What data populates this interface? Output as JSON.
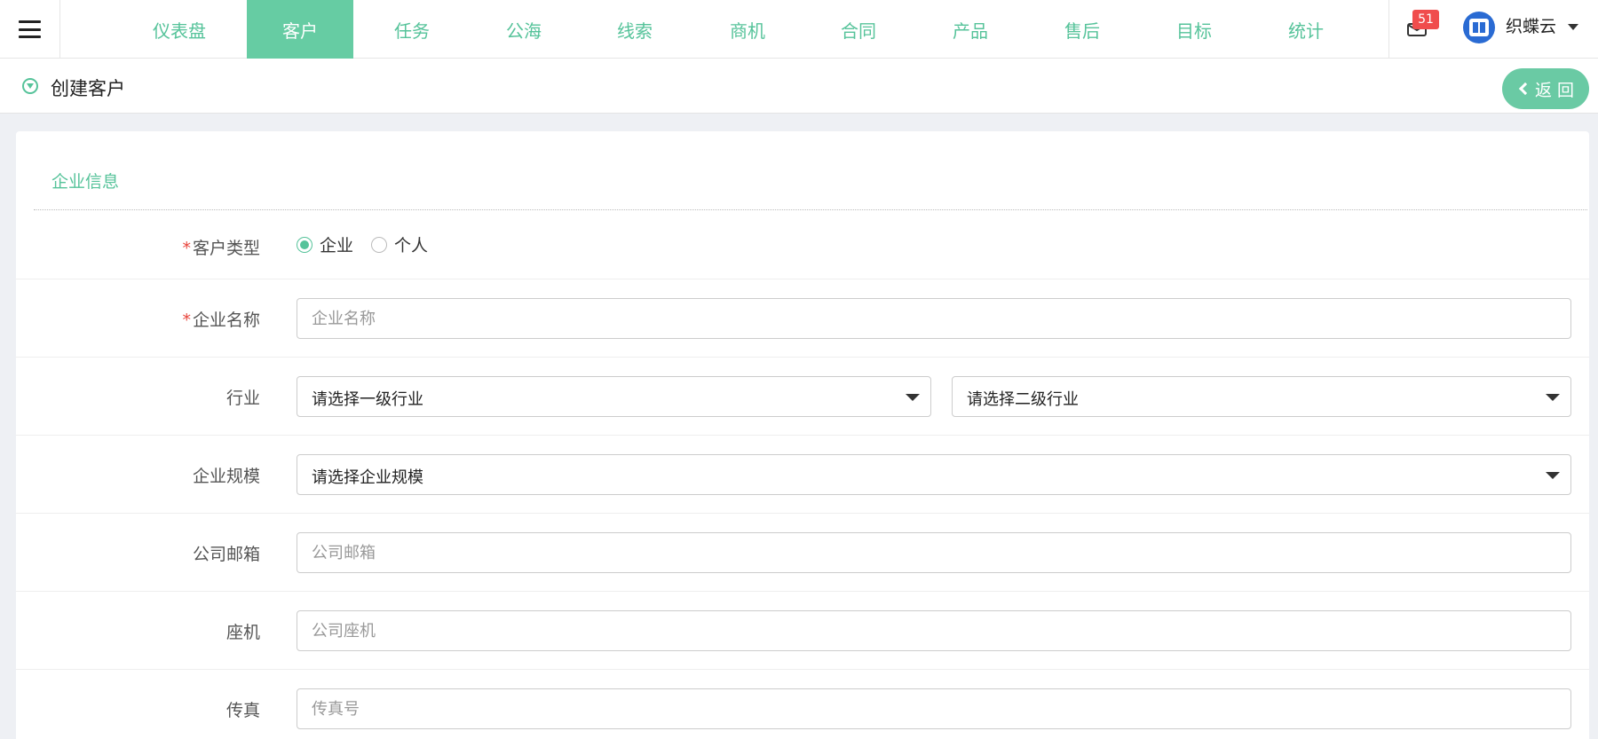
{
  "nav": {
    "items": [
      {
        "label": "仪表盘"
      },
      {
        "label": "客户"
      },
      {
        "label": "任务"
      },
      {
        "label": "公海"
      },
      {
        "label": "线索"
      },
      {
        "label": "商机"
      },
      {
        "label": "合同"
      },
      {
        "label": "产品"
      },
      {
        "label": "售后"
      },
      {
        "label": "目标"
      },
      {
        "label": "统计"
      }
    ],
    "active": "客户",
    "mail_count": "51",
    "user_name": "织蝶云"
  },
  "subheader": {
    "title": "创建客户",
    "back_label": "返 回"
  },
  "form": {
    "section_title": "企业信息",
    "customer_type": {
      "label": "客户类型",
      "options": [
        "企业",
        "个人"
      ],
      "selected": "企业"
    },
    "company_name": {
      "label": "企业名称",
      "placeholder": "企业名称"
    },
    "industry": {
      "label": "行业",
      "level1": "请选择一级行业",
      "level2": "请选择二级行业"
    },
    "scale": {
      "label": "企业规模",
      "value": "请选择企业规模"
    },
    "email": {
      "label": "公司邮箱",
      "placeholder": "公司邮箱"
    },
    "landline": {
      "label": "座机",
      "placeholder": "公司座机"
    },
    "fax": {
      "label": "传真",
      "placeholder": "传真号"
    }
  },
  "colors": {
    "accent": "#56c39a",
    "active_tab": "#66cca3",
    "badge": "#f04d4d",
    "required": "#e8453c"
  }
}
